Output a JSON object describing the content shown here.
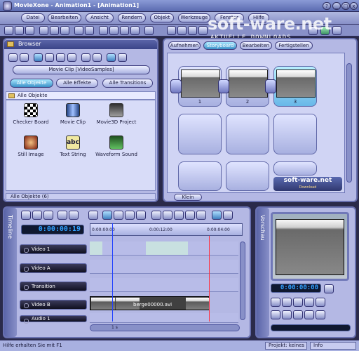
{
  "window": {
    "title": "MovieXone - Animation1 - [Animation1]"
  },
  "menu": [
    "Datei",
    "Bearbeiten",
    "Ansicht",
    "Rendern",
    "Objekt",
    "Werkzeuge",
    "Fenster",
    "Hilfe"
  ],
  "watermark": {
    "brand": "soft-ware.net",
    "sub": "AKTUELLE DOWNLOADS"
  },
  "browser": {
    "title": "Browser",
    "source": "Movie Clip [VideoSamples]",
    "filters": [
      "Alle Objekte",
      "Alle Effekte",
      "Alle Transitions"
    ],
    "tree_root": "Alle Objekte",
    "items": [
      "Checker Board",
      "Movie Clip",
      "Movie3D Project",
      "Still Image",
      "Text String",
      "Waveform Sound"
    ],
    "status": "Alle Objekte (6)"
  },
  "storyboard": {
    "tabs": [
      "Aufnehmen",
      "Storyboard",
      "Bearbeiten",
      "Fertigstellen"
    ],
    "frames": [
      "1",
      "2",
      "3"
    ],
    "zoom_label": "Klein",
    "badge": {
      "brand": "soft-ware.net",
      "sub": "Download"
    }
  },
  "timeline": {
    "side_label": "Timeline",
    "timecode": "0:00:00:19",
    "ruler": [
      "0:00:00:00",
      "0:00:12:00",
      "0:00:04:00"
    ],
    "tracks": [
      "Video 1",
      "Video A",
      "Transition",
      "Video B",
      "Audio 1"
    ],
    "clip_name": "berge00000.avi",
    "scroll_label": "1 s"
  },
  "preview": {
    "side_label": "Vorschau",
    "timecode": "0:00:00:00"
  },
  "status": {
    "hint": "Hilfe erhalten Sie mit F1",
    "project": "Projekt: keines",
    "info": "Info"
  },
  "colors": {
    "accent": "#3a90c8",
    "panel": "#b4b8e4",
    "timecode": "#30a0ff"
  }
}
